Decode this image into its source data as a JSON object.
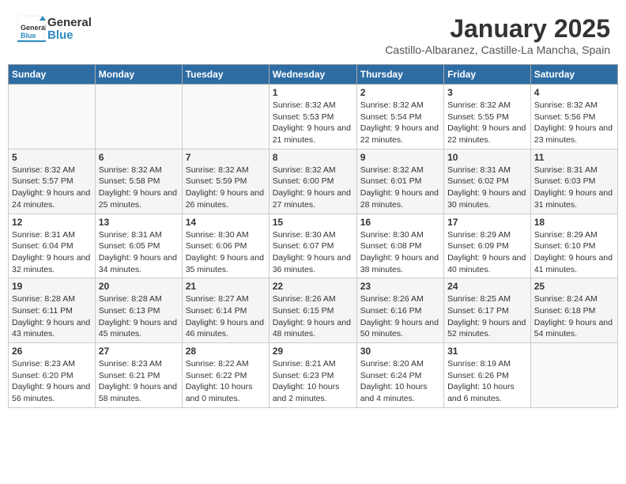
{
  "header": {
    "logo_general": "General",
    "logo_blue": "Blue",
    "month_title": "January 2025",
    "subtitle": "Castillo-Albaranez, Castille-La Mancha, Spain"
  },
  "weekdays": [
    "Sunday",
    "Monday",
    "Tuesday",
    "Wednesday",
    "Thursday",
    "Friday",
    "Saturday"
  ],
  "weeks": [
    [
      {
        "day": "",
        "sunrise": "",
        "sunset": "",
        "daylight": ""
      },
      {
        "day": "",
        "sunrise": "",
        "sunset": "",
        "daylight": ""
      },
      {
        "day": "",
        "sunrise": "",
        "sunset": "",
        "daylight": ""
      },
      {
        "day": "1",
        "sunrise": "Sunrise: 8:32 AM",
        "sunset": "Sunset: 5:53 PM",
        "daylight": "Daylight: 9 hours and 21 minutes."
      },
      {
        "day": "2",
        "sunrise": "Sunrise: 8:32 AM",
        "sunset": "Sunset: 5:54 PM",
        "daylight": "Daylight: 9 hours and 22 minutes."
      },
      {
        "day": "3",
        "sunrise": "Sunrise: 8:32 AM",
        "sunset": "Sunset: 5:55 PM",
        "daylight": "Daylight: 9 hours and 22 minutes."
      },
      {
        "day": "4",
        "sunrise": "Sunrise: 8:32 AM",
        "sunset": "Sunset: 5:56 PM",
        "daylight": "Daylight: 9 hours and 23 minutes."
      }
    ],
    [
      {
        "day": "5",
        "sunrise": "Sunrise: 8:32 AM",
        "sunset": "Sunset: 5:57 PM",
        "daylight": "Daylight: 9 hours and 24 minutes."
      },
      {
        "day": "6",
        "sunrise": "Sunrise: 8:32 AM",
        "sunset": "Sunset: 5:58 PM",
        "daylight": "Daylight: 9 hours and 25 minutes."
      },
      {
        "day": "7",
        "sunrise": "Sunrise: 8:32 AM",
        "sunset": "Sunset: 5:59 PM",
        "daylight": "Daylight: 9 hours and 26 minutes."
      },
      {
        "day": "8",
        "sunrise": "Sunrise: 8:32 AM",
        "sunset": "Sunset: 6:00 PM",
        "daylight": "Daylight: 9 hours and 27 minutes."
      },
      {
        "day": "9",
        "sunrise": "Sunrise: 8:32 AM",
        "sunset": "Sunset: 6:01 PM",
        "daylight": "Daylight: 9 hours and 28 minutes."
      },
      {
        "day": "10",
        "sunrise": "Sunrise: 8:31 AM",
        "sunset": "Sunset: 6:02 PM",
        "daylight": "Daylight: 9 hours and 30 minutes."
      },
      {
        "day": "11",
        "sunrise": "Sunrise: 8:31 AM",
        "sunset": "Sunset: 6:03 PM",
        "daylight": "Daylight: 9 hours and 31 minutes."
      }
    ],
    [
      {
        "day": "12",
        "sunrise": "Sunrise: 8:31 AM",
        "sunset": "Sunset: 6:04 PM",
        "daylight": "Daylight: 9 hours and 32 minutes."
      },
      {
        "day": "13",
        "sunrise": "Sunrise: 8:31 AM",
        "sunset": "Sunset: 6:05 PM",
        "daylight": "Daylight: 9 hours and 34 minutes."
      },
      {
        "day": "14",
        "sunrise": "Sunrise: 8:30 AM",
        "sunset": "Sunset: 6:06 PM",
        "daylight": "Daylight: 9 hours and 35 minutes."
      },
      {
        "day": "15",
        "sunrise": "Sunrise: 8:30 AM",
        "sunset": "Sunset: 6:07 PM",
        "daylight": "Daylight: 9 hours and 36 minutes."
      },
      {
        "day": "16",
        "sunrise": "Sunrise: 8:30 AM",
        "sunset": "Sunset: 6:08 PM",
        "daylight": "Daylight: 9 hours and 38 minutes."
      },
      {
        "day": "17",
        "sunrise": "Sunrise: 8:29 AM",
        "sunset": "Sunset: 6:09 PM",
        "daylight": "Daylight: 9 hours and 40 minutes."
      },
      {
        "day": "18",
        "sunrise": "Sunrise: 8:29 AM",
        "sunset": "Sunset: 6:10 PM",
        "daylight": "Daylight: 9 hours and 41 minutes."
      }
    ],
    [
      {
        "day": "19",
        "sunrise": "Sunrise: 8:28 AM",
        "sunset": "Sunset: 6:11 PM",
        "daylight": "Daylight: 9 hours and 43 minutes."
      },
      {
        "day": "20",
        "sunrise": "Sunrise: 8:28 AM",
        "sunset": "Sunset: 6:13 PM",
        "daylight": "Daylight: 9 hours and 45 minutes."
      },
      {
        "day": "21",
        "sunrise": "Sunrise: 8:27 AM",
        "sunset": "Sunset: 6:14 PM",
        "daylight": "Daylight: 9 hours and 46 minutes."
      },
      {
        "day": "22",
        "sunrise": "Sunrise: 8:26 AM",
        "sunset": "Sunset: 6:15 PM",
        "daylight": "Daylight: 9 hours and 48 minutes."
      },
      {
        "day": "23",
        "sunrise": "Sunrise: 8:26 AM",
        "sunset": "Sunset: 6:16 PM",
        "daylight": "Daylight: 9 hours and 50 minutes."
      },
      {
        "day": "24",
        "sunrise": "Sunrise: 8:25 AM",
        "sunset": "Sunset: 6:17 PM",
        "daylight": "Daylight: 9 hours and 52 minutes."
      },
      {
        "day": "25",
        "sunrise": "Sunrise: 8:24 AM",
        "sunset": "Sunset: 6:18 PM",
        "daylight": "Daylight: 9 hours and 54 minutes."
      }
    ],
    [
      {
        "day": "26",
        "sunrise": "Sunrise: 8:23 AM",
        "sunset": "Sunset: 6:20 PM",
        "daylight": "Daylight: 9 hours and 56 minutes."
      },
      {
        "day": "27",
        "sunrise": "Sunrise: 8:23 AM",
        "sunset": "Sunset: 6:21 PM",
        "daylight": "Daylight: 9 hours and 58 minutes."
      },
      {
        "day": "28",
        "sunrise": "Sunrise: 8:22 AM",
        "sunset": "Sunset: 6:22 PM",
        "daylight": "Daylight: 10 hours and 0 minutes."
      },
      {
        "day": "29",
        "sunrise": "Sunrise: 8:21 AM",
        "sunset": "Sunset: 6:23 PM",
        "daylight": "Daylight: 10 hours and 2 minutes."
      },
      {
        "day": "30",
        "sunrise": "Sunrise: 8:20 AM",
        "sunset": "Sunset: 6:24 PM",
        "daylight": "Daylight: 10 hours and 4 minutes."
      },
      {
        "day": "31",
        "sunrise": "Sunrise: 8:19 AM",
        "sunset": "Sunset: 6:26 PM",
        "daylight": "Daylight: 10 hours and 6 minutes."
      },
      {
        "day": "",
        "sunrise": "",
        "sunset": "",
        "daylight": ""
      }
    ]
  ]
}
